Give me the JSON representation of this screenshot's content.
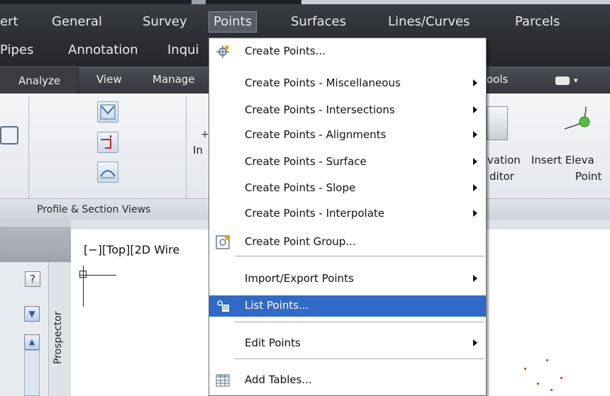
{
  "menubar": {
    "items": [
      "ert",
      "General",
      "Survey",
      "Points",
      "Surfaces",
      "Lines/Curves",
      "Parcels"
    ],
    "row2": [
      "Pipes",
      "Annotation",
      "Inqui"
    ]
  },
  "tabs": [
    "Analyze",
    "View",
    "Manage"
  ],
  "tab_right": {
    "tools": "ools"
  },
  "ribbon": {
    "panel_title": "Profile & Section Views",
    "in_label": "In",
    "elevation_editor_1": "vation",
    "elevation_editor_2": "ditor",
    "insert_elev_1": "Insert Eleva",
    "insert_elev_2": "Point"
  },
  "points_menu": {
    "items": [
      {
        "label": "Create Points...",
        "submenu": false,
        "icon": "create-points-icon"
      },
      {
        "label": "Create Points - Miscellaneous",
        "submenu": true
      },
      {
        "label": "Create Points - Intersections",
        "submenu": true
      },
      {
        "label": "Create Points - Alignments",
        "submenu": true
      },
      {
        "label": "Create Points - Surface",
        "submenu": true
      },
      {
        "label": "Create Points - Slope",
        "submenu": true
      },
      {
        "label": "Create Points - Interpolate",
        "submenu": true
      },
      {
        "label": "Create Point Group...",
        "submenu": false,
        "icon": "point-group-icon"
      },
      {
        "label": "Import/Export Points",
        "submenu": true
      },
      {
        "label": "List Points...",
        "submenu": false,
        "icon": "list-points-icon",
        "highlighted": true
      },
      {
        "label": "Edit Points",
        "submenu": true
      },
      {
        "label": "Add Tables...",
        "submenu": false,
        "icon": "table-icon"
      }
    ],
    "highlight_color": "#3169c6"
  },
  "viewport": {
    "label": "[−][Top][2D Wire"
  },
  "prospector": {
    "tab_label": "Prospector",
    "help": "?"
  }
}
